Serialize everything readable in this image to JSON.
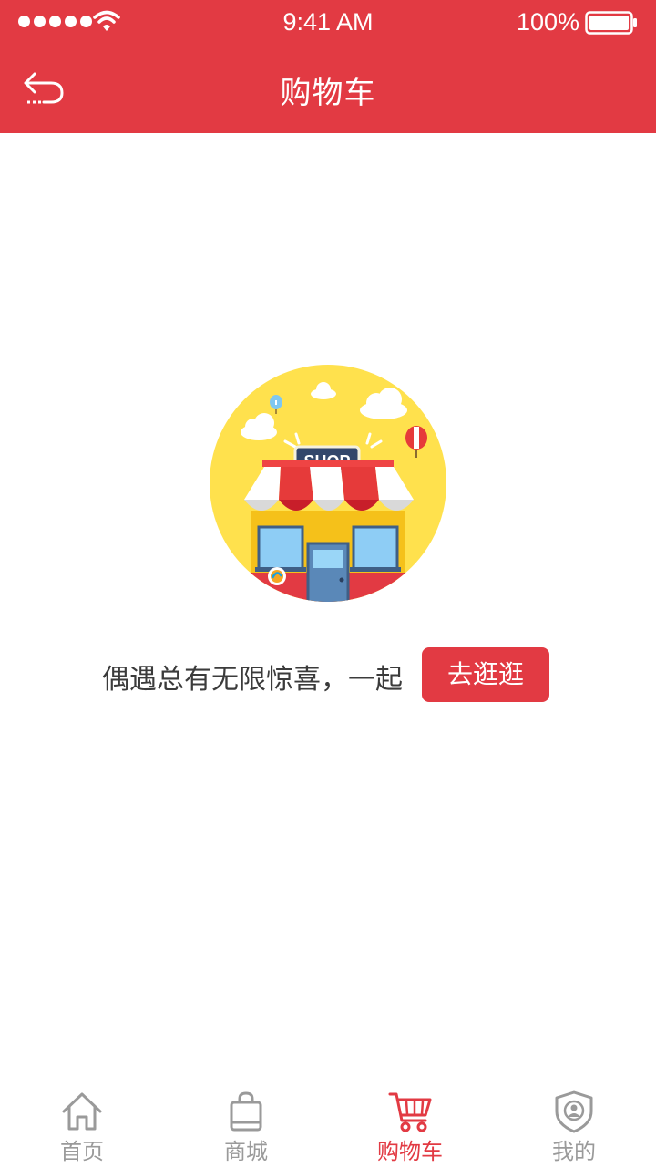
{
  "status_bar": {
    "time": "9:41 AM",
    "battery_percent": "100%",
    "signal_icon": "signal-dots-icon",
    "wifi_icon": "wifi-icon",
    "battery_icon": "battery-icon"
  },
  "header": {
    "title": "购物车",
    "back_icon": "back-arrow-icon",
    "background_color": "#e23a43"
  },
  "empty_state": {
    "illustration": "shop-illustration",
    "illustration_sign": "SHOP",
    "message": "偶遇总有无限惊喜，一起",
    "button_label": "去逛逛"
  },
  "tabbar": {
    "active_color": "#e23a43",
    "items": [
      {
        "label": "首页",
        "icon": "home-icon",
        "active": false
      },
      {
        "label": "商城",
        "icon": "shopping-bag-icon",
        "active": false
      },
      {
        "label": "购物车",
        "icon": "shopping-cart-icon",
        "active": true
      },
      {
        "label": "我的",
        "icon": "user-shield-icon",
        "active": false
      }
    ]
  }
}
